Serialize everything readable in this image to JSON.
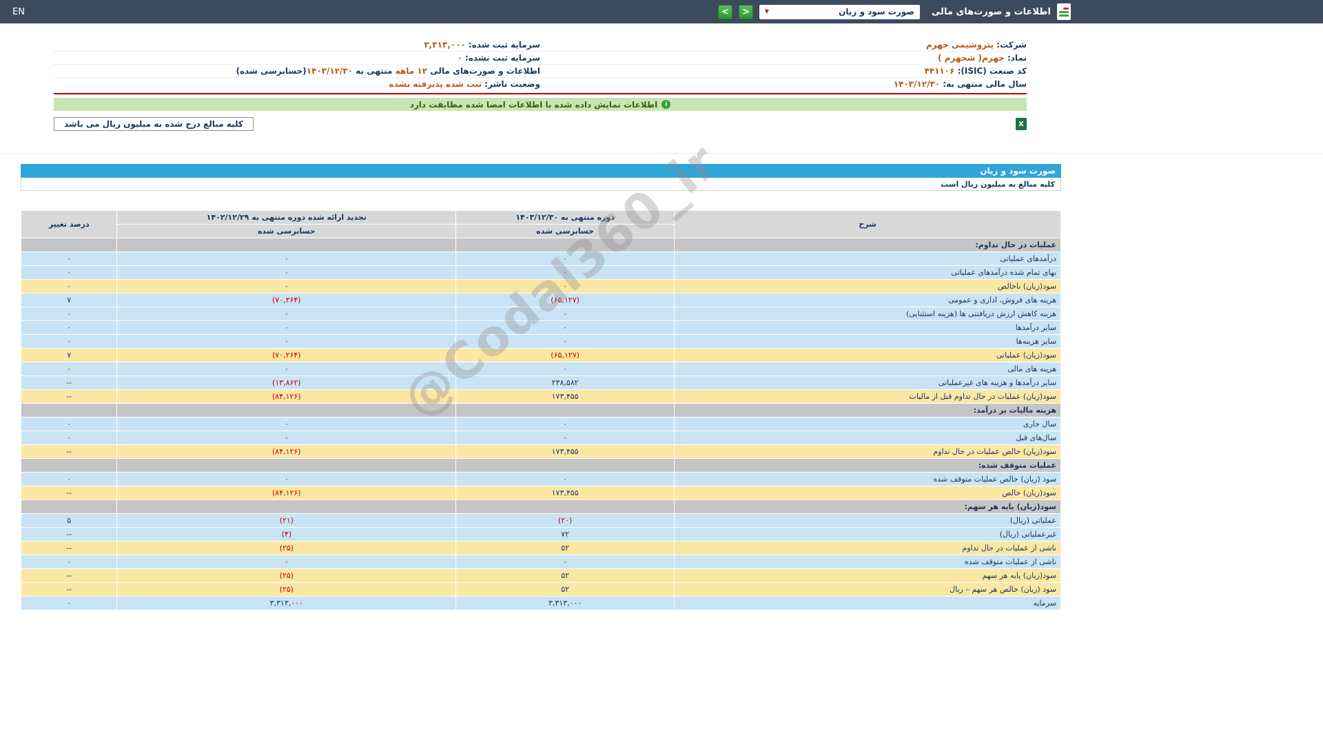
{
  "topbar": {
    "title": "اطلاعات و صورت‌های مالی",
    "dropdown_value": "صورت سود و زیان",
    "lang": "EN"
  },
  "icons": {
    "chevron_down": "▼",
    "nav_right": ">",
    "nav_left": "<",
    "info": "i",
    "excel": "X"
  },
  "company_info": {
    "right_rows": [
      [
        {
          "t": "شرکت:  ",
          "s": "label"
        },
        {
          "t": "پتروشیمی جهرم",
          "s": "value"
        }
      ],
      [
        {
          "t": "نماد:  ",
          "s": "label"
        },
        {
          "t": "جهرم( شجهرم )",
          "s": "value"
        }
      ],
      [
        {
          "t": "کد صنعت (ISIC):  ",
          "s": "label"
        },
        {
          "t": "۴۴۱۱۰۶",
          "s": "value"
        }
      ],
      [
        {
          "t": "سال مالی منتهی به:  ",
          "s": "label"
        },
        {
          "t": "۱۴۰۳/۱۲/۳۰",
          "s": "value"
        }
      ]
    ],
    "left_rows": [
      [
        {
          "t": "سرمایه ثبت شده:  ",
          "s": "label"
        },
        {
          "t": "۳,۳۱۳,۰۰۰",
          "s": "value"
        }
      ],
      [
        {
          "t": "سرمایه ثبت نشده:  ",
          "s": "label"
        },
        {
          "t": "۰",
          "s": "value"
        }
      ],
      [
        {
          "t": "اطلاعات و صورت‌های مالی ",
          "s": "label"
        },
        {
          "t": "۱۲ ماهه",
          "s": "value"
        },
        {
          "t": " منتهی به ",
          "s": "label"
        },
        {
          "t": "۱۴۰۳/۱۲/۳۰",
          "s": "value"
        },
        {
          "t": "(حسابرسی شده)",
          "s": "label"
        }
      ],
      [
        {
          "t": "وضعیت ناشر:  ",
          "s": "label"
        },
        {
          "t": "ثبت شده پذیرفته نشده",
          "s": "value"
        }
      ]
    ]
  },
  "signature_bar": {
    "text": "اطلاعات نمایش داده شده با اطلاعات امضا شده مطابقت دارد"
  },
  "unit_note": "کلیه مبالغ درج شده به میلیون ریال می باشد",
  "statement": {
    "title": "صورت سود و زیان",
    "unit_line": "کلیه مبالغ به میلیون ریال است",
    "columns": {
      "desc": "شرح",
      "period_current": "دوره منتهی به ۱۴۰۳/۱۲/۳۰",
      "period_restated": "تجدید ارائه شده دوره منتهی به ۱۴۰۲/۱۲/۲۹",
      "audited": "حسابرسی شده",
      "change": "درصد تغییر"
    },
    "rows": [
      {
        "type": "section",
        "label": "عملیات در حال تداوم:"
      },
      {
        "type": "data",
        "shade": "blue",
        "label": "درآمدهای عملیاتی",
        "v1": "۰",
        "v2": "۰",
        "pct": "۰"
      },
      {
        "type": "data",
        "shade": "blue",
        "label": "بهای تمام شده درآمدهای عملیاتی",
        "v1": "۰",
        "v2": "۰",
        "pct": "۰"
      },
      {
        "type": "data",
        "shade": "yellow",
        "label": "سود(زیان) ناخالص",
        "v1": "۰",
        "v2": "۰",
        "pct": "۰"
      },
      {
        "type": "data",
        "shade": "blue",
        "label": "هزینه های فروش، اداری و عمومی",
        "v1": "(۶۵,۱۲۷)",
        "v2": "(۷۰,۲۶۴)",
        "pct": "۷"
      },
      {
        "type": "data",
        "shade": "blue",
        "label": "هزینه کاهش ارزش دریافتنی ها (هزینه استثنایی)",
        "v1": "۰",
        "v2": "۰",
        "pct": "۰"
      },
      {
        "type": "data",
        "shade": "blue",
        "label": "سایر درآمدها",
        "v1": "۰",
        "v2": "۰",
        "pct": "۰"
      },
      {
        "type": "data",
        "shade": "blue",
        "label": "سایر هزینه‌ها",
        "v1": "۰",
        "v2": "۰",
        "pct": "۰"
      },
      {
        "type": "data",
        "shade": "yellow",
        "label": "سود(زیان) عملیاتی",
        "v1": "(۶۵,۱۲۷)",
        "v2": "(۷۰,۲۶۴)",
        "pct": "۷"
      },
      {
        "type": "data",
        "shade": "blue",
        "label": "هزینه های مالی",
        "v1": "۰",
        "v2": "۰",
        "pct": "۰"
      },
      {
        "type": "data",
        "shade": "blue",
        "label": "سایر درآمدها و هزینه های غیرعملیاتی",
        "v1": "۲۳۸,۵۸۲",
        "v2": "(۱۳,۸۶۲)",
        "pct": "--"
      },
      {
        "type": "data",
        "shade": "yellow",
        "label": "سود(زیان) عملیات در حال تداوم قبل از مالیات",
        "v1": "۱۷۳,۴۵۵",
        "v2": "(۸۴,۱۲۶)",
        "pct": "--"
      },
      {
        "type": "section",
        "label": "هزینه مالیات بر درآمد:"
      },
      {
        "type": "data",
        "shade": "blue",
        "label": "سال جاری",
        "v1": "۰",
        "v2": "۰",
        "pct": "۰"
      },
      {
        "type": "data",
        "shade": "blue",
        "label": "سال‌های قبل",
        "v1": "۰",
        "v2": "۰",
        "pct": "۰"
      },
      {
        "type": "data",
        "shade": "yellow",
        "label": "سود(زیان) خالص عملیات در حال تداوم",
        "v1": "۱۷۳,۴۵۵",
        "v2": "(۸۴,۱۲۶)",
        "pct": "--"
      },
      {
        "type": "section",
        "label": "عملیات متوقف شده:"
      },
      {
        "type": "data",
        "shade": "blue",
        "label": "سود (زیان) خالص عملیات متوقف شده",
        "v1": "۰",
        "v2": "۰",
        "pct": "۰"
      },
      {
        "type": "data",
        "shade": "yellow",
        "label": "سود(زیان) خالص",
        "v1": "۱۷۳,۴۵۵",
        "v2": "(۸۴,۱۲۶)",
        "pct": "--"
      },
      {
        "type": "section",
        "label": "سود(زیان) پایه هر سهم:"
      },
      {
        "type": "data",
        "shade": "blue",
        "label": "عملیاتی (ریال)",
        "v1": "(۲۰)",
        "v2": "(۲۱)",
        "pct": "۵"
      },
      {
        "type": "data",
        "shade": "blue",
        "label": "غیرعملیاتی (ریال)",
        "v1": "۷۲",
        "v2": "(۴)",
        "pct": "--"
      },
      {
        "type": "data",
        "shade": "yellow",
        "label": "ناشی از عملیات در حال تداوم",
        "v1": "۵۲",
        "v2": "(۲۵)",
        "pct": "--"
      },
      {
        "type": "data",
        "shade": "blue",
        "label": "ناشی از عملیات متوقف شده",
        "v1": "۰",
        "v2": "۰",
        "pct": "۰"
      },
      {
        "type": "data",
        "shade": "yellow",
        "label": "سود(زیان) پایه هر سهم",
        "v1": "۵۲",
        "v2": "(۲۵)",
        "pct": "--"
      },
      {
        "type": "data",
        "shade": "yellow",
        "label": "سود (زیان) خالص هر سهم – ریال",
        "v1": "۵۲",
        "v2": "(۲۵)",
        "pct": "--"
      },
      {
        "type": "data",
        "shade": "blue",
        "label": "سرمایه",
        "v1": "۳,۳۱۳,۰۰۰",
        "v2": "۳,۳۱۳,۰۰۰",
        "pct": "۰"
      }
    ]
  },
  "watermark": "@Codal360_ir"
}
